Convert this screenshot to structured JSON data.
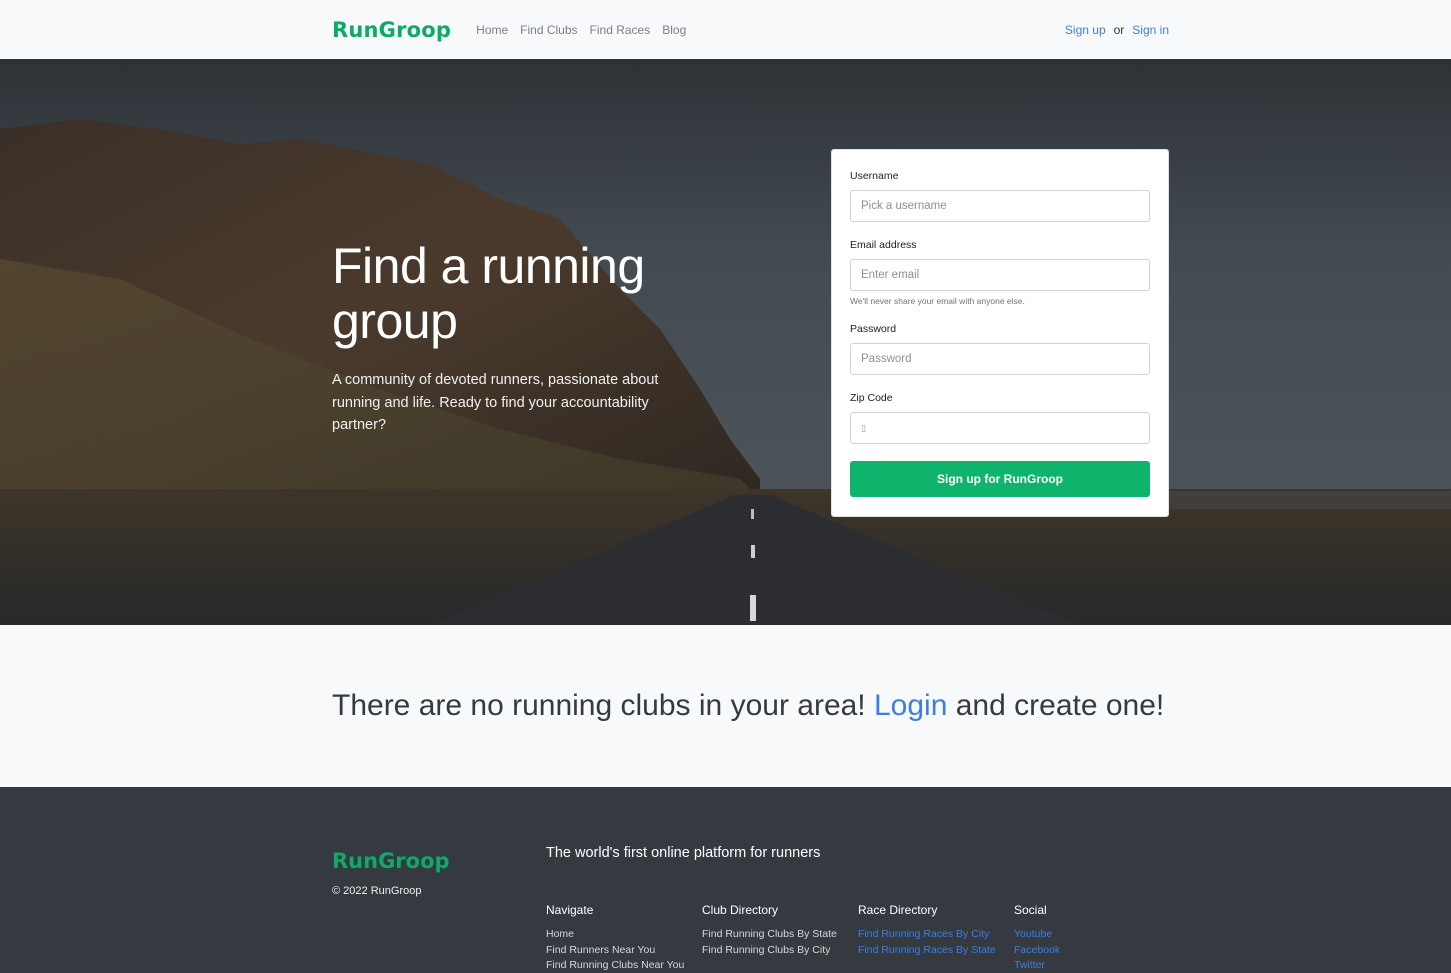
{
  "nav": {
    "brand": "RunGroop",
    "links": [
      "Home",
      "Find Clubs",
      "Find Races",
      "Blog"
    ],
    "signup": "Sign up",
    "or": "or",
    "signin": "Sign in"
  },
  "hero": {
    "title": "Find a running group",
    "subtitle": "A community of devoted runners, passionate about running and life. Ready to find your accountability partner?"
  },
  "form": {
    "username_label": "Username",
    "username_placeholder": "Pick a username",
    "email_label": "Email address",
    "email_placeholder": "Enter email",
    "email_help": "We'll never share your email with anyone else.",
    "password_label": "Password",
    "password_placeholder": "Password",
    "zip_label": "Zip Code",
    "zip_value": "▯",
    "submit": "Sign up for RunGroop"
  },
  "message": {
    "before": "There are no running clubs in your area!",
    "link": "Login",
    "after": "and create one!"
  },
  "footer": {
    "brand": "RunGroop",
    "copyright": "© 2022 RunGroop",
    "tagline": "The world's first online platform for runners",
    "columns": [
      {
        "title": "Navigate",
        "links": [
          "Home",
          "Find Runners Near You",
          "Find Running Clubs Near You"
        ]
      },
      {
        "title": "Club Directory",
        "links": [
          "Find Running Clubs By State",
          "Find Running Clubs By City"
        ]
      },
      {
        "title": "Race Directory",
        "links": [
          "Find Running Races By City",
          "Find Running Races By State"
        ]
      },
      {
        "title": "Social",
        "links": [
          "Youtube",
          "Facebook",
          "Twitter"
        ]
      }
    ]
  },
  "colors": {
    "brand": "#0fa968",
    "button": "#0fb46c",
    "link": "#3d7fe0",
    "footer_bg": "#343a40"
  }
}
